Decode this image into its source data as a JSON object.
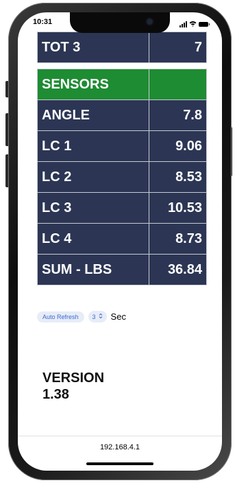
{
  "status": {
    "time": "10:31"
  },
  "table": {
    "top_partial": {
      "label": "TOT 3",
      "value": "7"
    },
    "header": {
      "label": "SENSORS",
      "value": ""
    },
    "rows": [
      {
        "label": "ANGLE",
        "value": "7.8"
      },
      {
        "label": "LC 1",
        "value": "9.06"
      },
      {
        "label": "LC 2",
        "value": "8.53"
      },
      {
        "label": "LC 3",
        "value": "10.53"
      },
      {
        "label": "LC 4",
        "value": "8.73"
      },
      {
        "label": "SUM - LBS",
        "value": "36.84"
      }
    ]
  },
  "controls": {
    "auto_refresh_label": "Auto Refresh",
    "interval_value": "3",
    "unit_label": "Sec"
  },
  "version": {
    "title": "VERSION",
    "number": "1.38"
  },
  "browser": {
    "address": "192.168.4.1"
  },
  "colors": {
    "row_bg": "#2c3654",
    "header_bg": "#1e8c33"
  }
}
